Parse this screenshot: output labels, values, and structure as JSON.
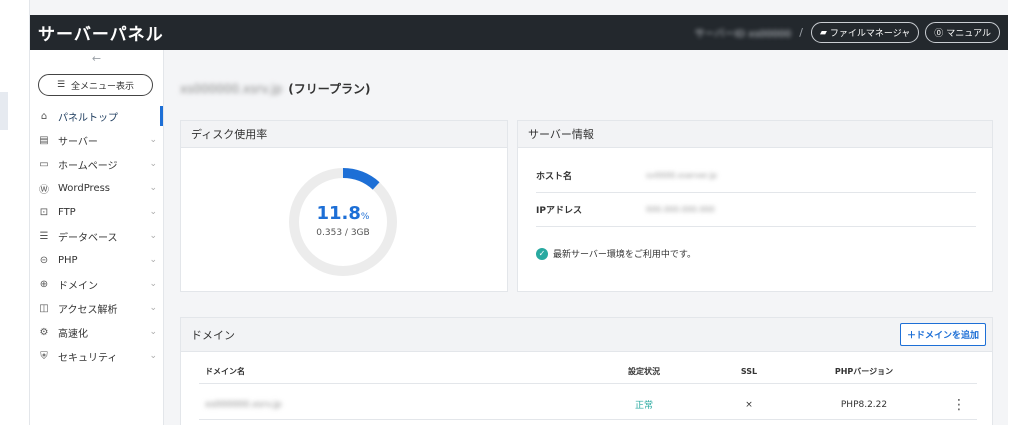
{
  "app": {
    "title": "サーバーパネル",
    "account": "サーバーID xs00000"
  },
  "top": {
    "separator": "/",
    "file_manager": "ファイルマネージャ",
    "manual": "マニュアル"
  },
  "sidebar": {
    "collapse": "←",
    "all_menu": "全メニュー表示",
    "items": [
      {
        "label": "パネルトップ",
        "icon": "home-icon",
        "glyph": "⌂"
      },
      {
        "label": "サーバー",
        "icon": "server-icon",
        "glyph": "▤"
      },
      {
        "label": "ホームページ",
        "icon": "window-icon",
        "glyph": "▭"
      },
      {
        "label": "WordPress",
        "icon": "wordpress-icon",
        "glyph": "Ⓦ"
      },
      {
        "label": "FTP",
        "icon": "monitor-icon",
        "glyph": "⊡"
      },
      {
        "label": "データベース",
        "icon": "database-icon",
        "glyph": "☰"
      },
      {
        "label": "PHP",
        "icon": "php-icon",
        "glyph": "⊝"
      },
      {
        "label": "ドメイン",
        "icon": "globe-icon",
        "glyph": "⊕"
      },
      {
        "label": "アクセス解析",
        "icon": "chart-icon",
        "glyph": "◫"
      },
      {
        "label": "高速化",
        "icon": "speed-icon",
        "glyph": "⚙"
      },
      {
        "label": "セキュリティ",
        "icon": "shield-icon",
        "glyph": "⛨"
      }
    ]
  },
  "header": {
    "domain": "xs000000.xsrv.jp",
    "plan": "(フリープラン)"
  },
  "disk": {
    "title": "ディスク使用率",
    "percent": "11.8",
    "unit": "%",
    "usage": "0.353 / 3GB",
    "fraction": 0.118,
    "color": "#1d6fd6"
  },
  "server": {
    "title": "サーバー情報",
    "host_label": "ホスト名",
    "host_value": "sv0000.xserver.jp",
    "ip_label": "IPアドレス",
    "ip_value": "000.000.000.000",
    "status": "最新サーバー環境をご利用中です。"
  },
  "domains": {
    "title": "ドメイン",
    "add_button": "＋ドメインを追加",
    "columns": [
      "ドメイン名",
      "設定状況",
      "SSL",
      "PHPバージョン"
    ],
    "rows": [
      {
        "name": "xs000000.xsrv.jp",
        "status": "正常",
        "ssl": "×",
        "php": "PHP8.2.22"
      }
    ]
  }
}
